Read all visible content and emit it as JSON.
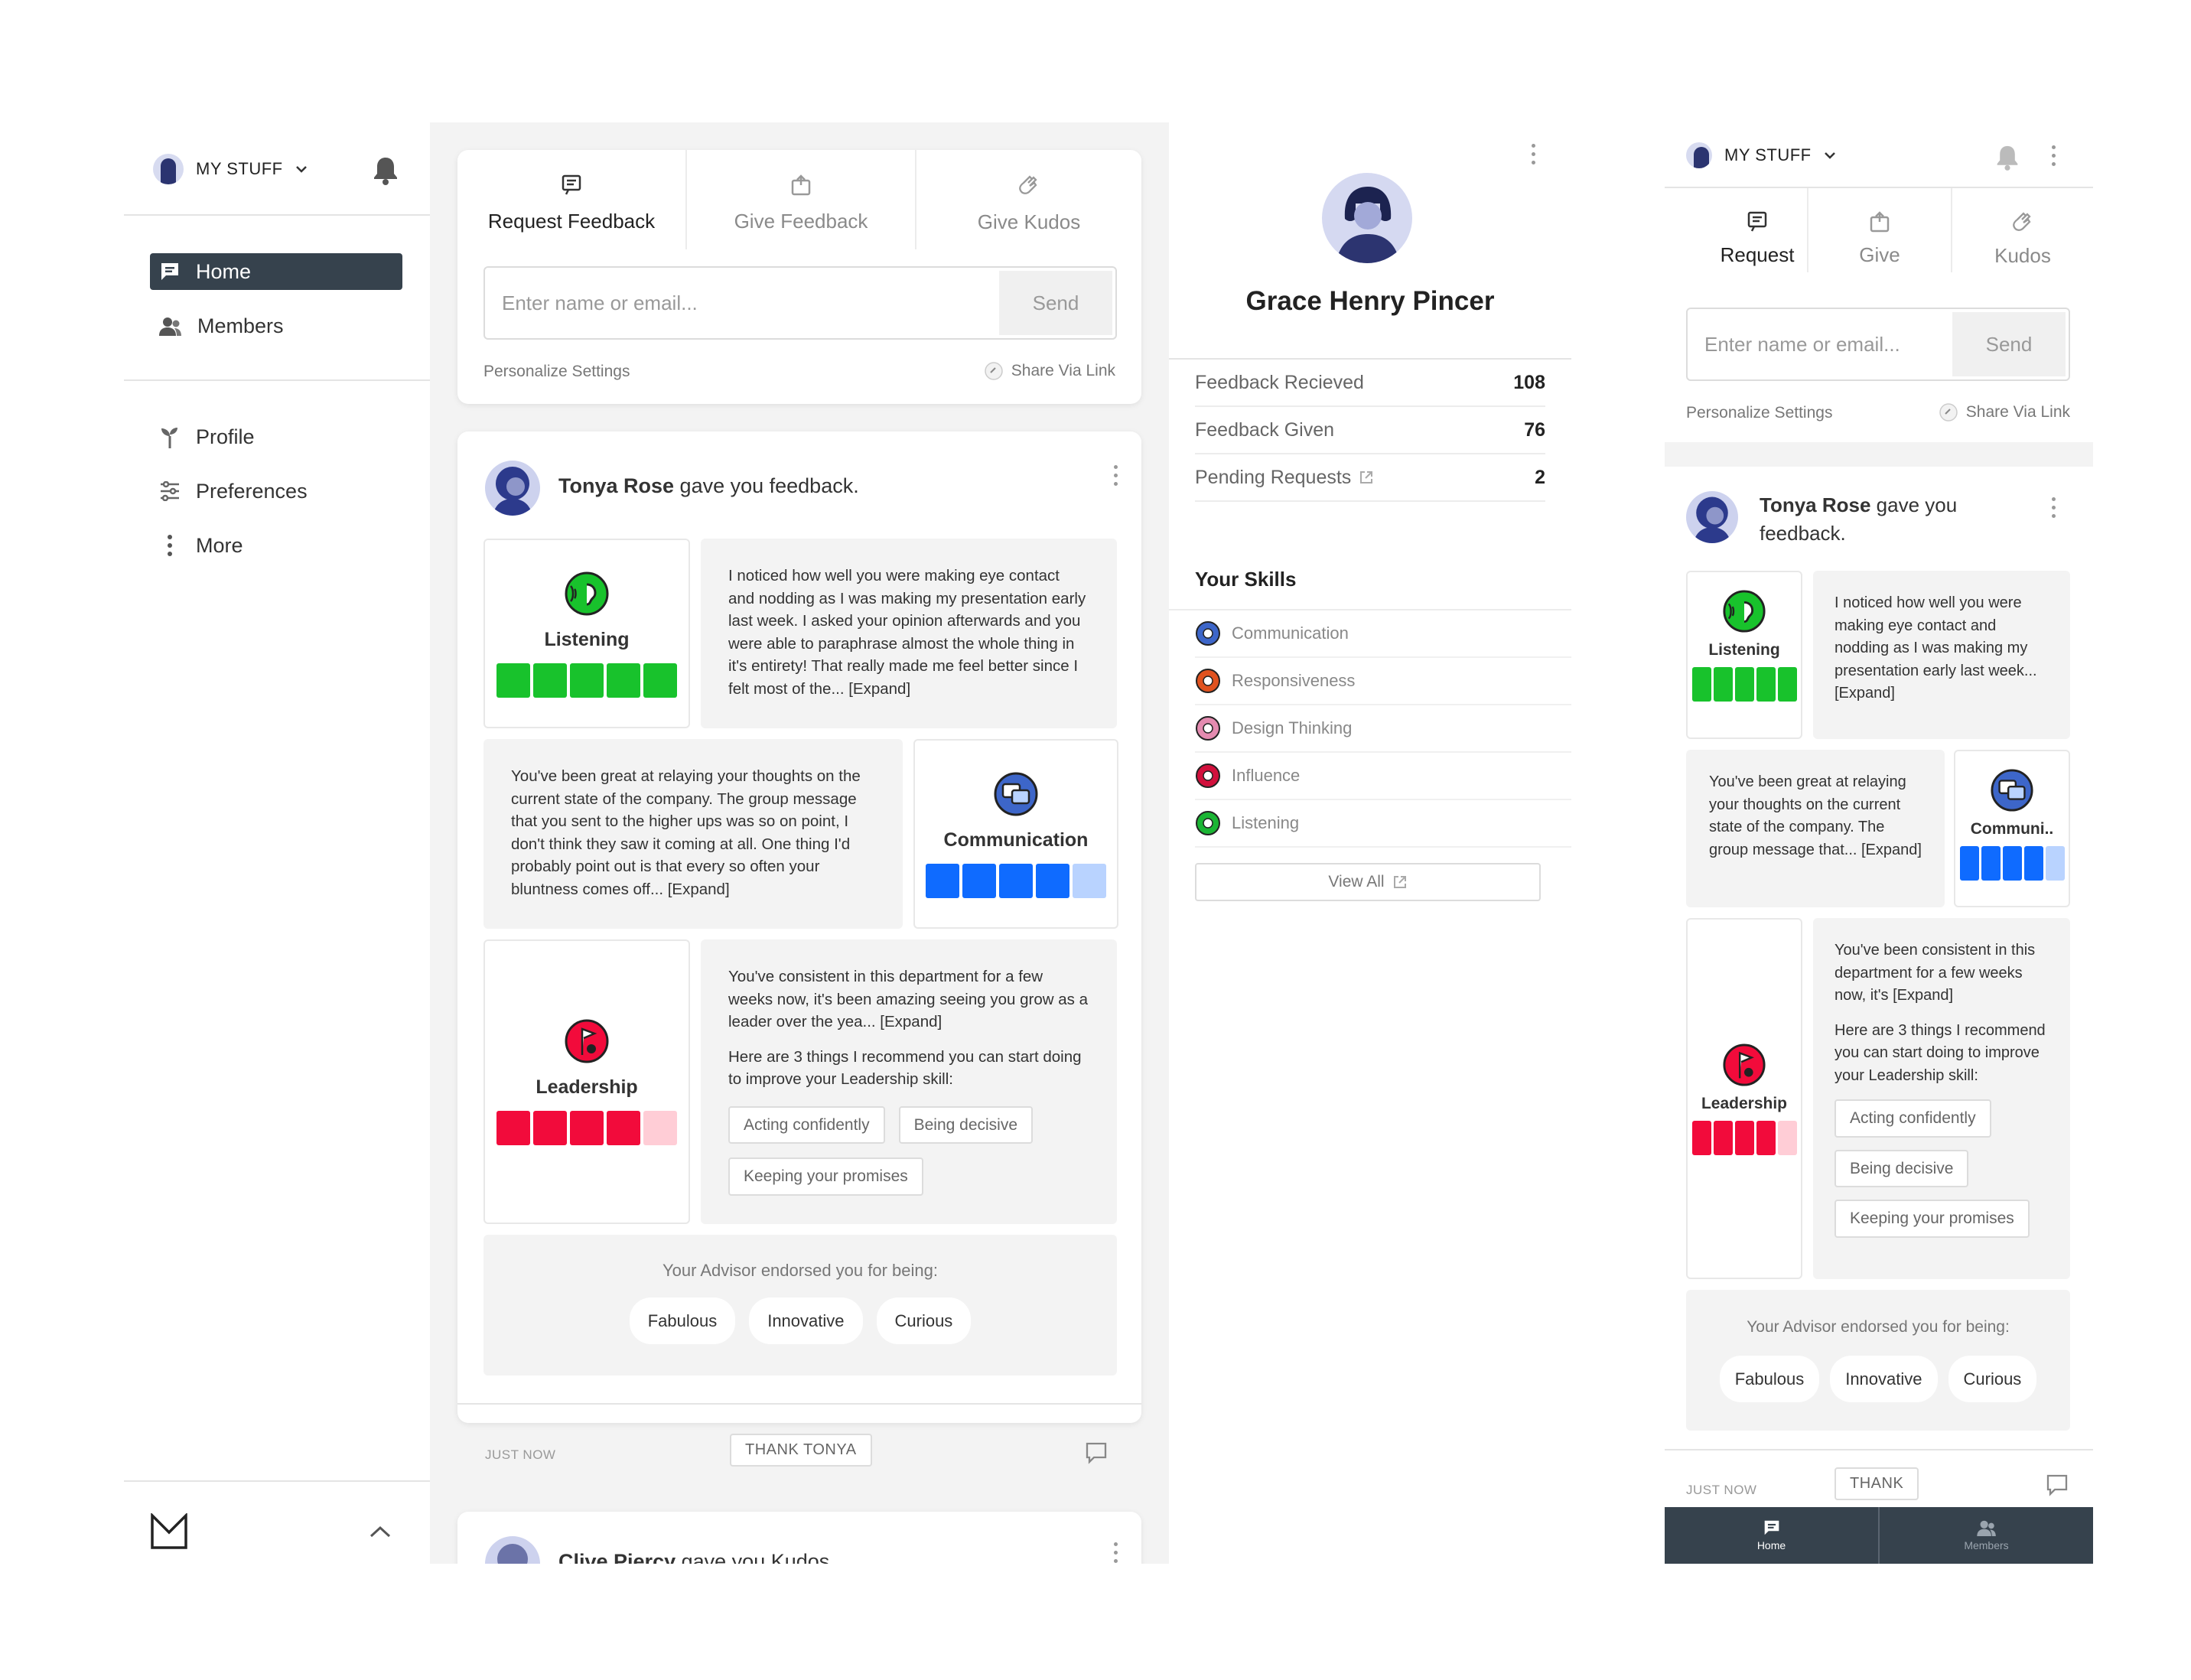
{
  "sidebar": {
    "my_stuff": "MY STUFF",
    "nav": [
      {
        "label": "Home",
        "icon": "chat-icon",
        "active": true
      },
      {
        "label": "Members",
        "icon": "members-icon"
      },
      {
        "label": "Profile",
        "icon": "sprout-icon"
      },
      {
        "label": "Preferences",
        "icon": "sliders-icon"
      },
      {
        "label": "More",
        "icon": "more-vertical-icon"
      }
    ]
  },
  "composer": {
    "tabs": [
      "Request Feedback",
      "Give Feedback",
      "Give Kudos"
    ],
    "placeholder": "Enter name or email...",
    "send": "Send",
    "personalize": "Personalize Settings",
    "share": "Share Via Link"
  },
  "post": {
    "author": "Tonya Rose",
    "action": "gave you feedback.",
    "listening": {
      "label": "Listening",
      "level": 5,
      "of": 5,
      "color": "#18c22c",
      "text": "I noticed how well you were making eye contact and nodding as I was making my presentation early last week. I asked your opinion afterwards and you were able to paraphrase almost the whole thing in it's entirety! That really made me feel better since I felt most of the...  [Expand]"
    },
    "communication": {
      "label": "Communication",
      "level": 4,
      "of": 5,
      "color": "#0f6bff",
      "light": "#b9d3ff",
      "text": "You've been great at relaying your thoughts on the current state of the company. The group message that you sent to the higher ups was so on point, I don't think they saw it coming at all. One thing I'd probably point out is that every so often your bluntness comes off...  [Expand]"
    },
    "leadership": {
      "label": "Leadership",
      "level": 4,
      "of": 5,
      "color": "#f20b3b",
      "light": "#ffcdd6",
      "text": "You've consistent in this department for a few weeks now, it's been amazing seeing you grow as a leader over the yea... [Expand]",
      "text2": "Here are 3 things I recommend you can start doing to improve your Leadership skill:",
      "chips": [
        "Acting confidently",
        "Being decisive",
        "Keeping your promises"
      ]
    },
    "advisor_title": "Your Advisor endorsed you for being:",
    "endorsements": [
      "Fabulous",
      "Innovative",
      "Curious"
    ],
    "time": "JUST NOW",
    "thank": "THANK TONYA"
  },
  "next_post": {
    "author": "Clive Piercy",
    "action": "gave you Kudos"
  },
  "profile": {
    "name": "Grace Henry Pincer",
    "stats": [
      {
        "label": "Feedback Recieved",
        "value": "108"
      },
      {
        "label": "Feedback Given",
        "value": "76"
      },
      {
        "label": "Pending Requests",
        "value": "2"
      }
    ],
    "skills_title": "Your Skills",
    "skills": [
      {
        "label": "Communication",
        "color": "#3d66c9"
      },
      {
        "label": "Responsiveness",
        "color": "#e0521f"
      },
      {
        "label": "Design Thinking",
        "color": "#e48bb0"
      },
      {
        "label": "Influence",
        "color": "#d1103c"
      },
      {
        "label": "Listening",
        "color": "#1bb534"
      }
    ],
    "view_all": "View All"
  },
  "mobile": {
    "my_stuff": "MY STUFF",
    "tabs": [
      "Request",
      "Give",
      "Kudos"
    ],
    "placeholder": "Enter name or email...",
    "send": "Send",
    "personalize": "Personalize Settings",
    "share": "Share Via Link",
    "author": "Tonya Rose",
    "action": "gave you feedback.",
    "listening_text": "I noticed how well you were making eye contact and nodding as I was making my presentation early last week...  [Expand]",
    "communication_label": "Communi..",
    "communication_text": "You've been great at relaying your thoughts on the current state of the company. The group message that... [Expand]",
    "leadership_text": "You've been consistent in this department for a few weeks now, it's [Expand]",
    "leadership_text2": "Here are 3 things I recommend you can start doing to improve your Leadership skill:",
    "thank": "THANK",
    "bottom": [
      "Home",
      "Members"
    ]
  }
}
